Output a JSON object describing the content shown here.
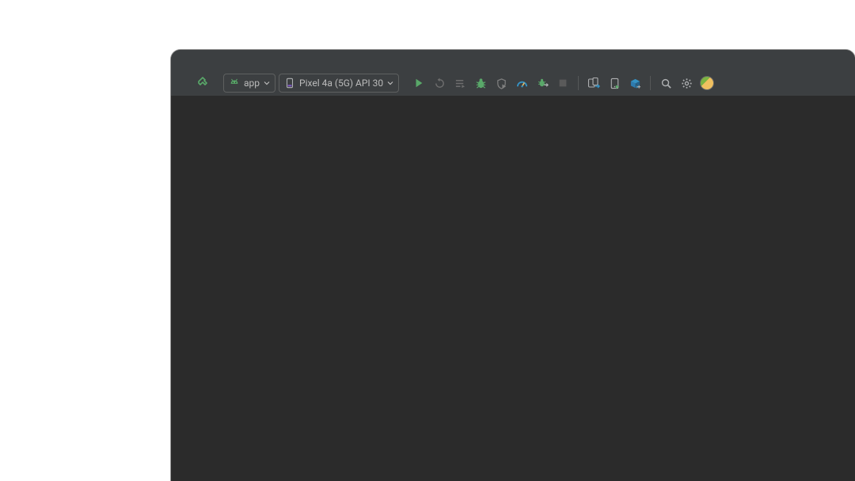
{
  "toolbar": {
    "build_icon": "hammer-icon",
    "module_selector": {
      "icon": "android-icon",
      "label": "app"
    },
    "device_selector": {
      "icon": "phone-icon",
      "label": "Pixel 4a (5G) API 30"
    },
    "run_icon": "play-icon",
    "apply_changes_icon": "apply-changes-restart-icon",
    "apply_code_icon": "apply-code-changes-icon",
    "debug_icon": "debug-icon",
    "coverage_icon": "run-coverage-icon",
    "profiler_icon": "profiler-icon",
    "attach_debugger_icon": "attach-debugger-icon",
    "stop_icon": "stop-icon",
    "avd_manager_icon": "avd-manager-icon",
    "sdk_manager_icon": "sdk-manager-icon",
    "resource_manager_icon": "resource-manager-icon",
    "search_icon": "search-icon",
    "settings_icon": "gear-icon",
    "account_icon": "avatar-icon"
  }
}
